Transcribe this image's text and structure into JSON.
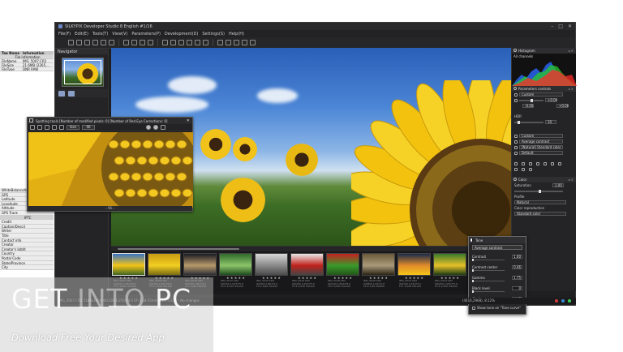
{
  "window": {
    "title": "SILKYPIX Developer Studio 8 English  #1/16",
    "controls": [
      "–",
      "□",
      "✕"
    ]
  },
  "menu": [
    "File(F)",
    "Edit(E)",
    "Tools(T)",
    "View(V)",
    "Parameters(P)",
    "Development(D)",
    "Settings(S)",
    "Help(H)"
  ],
  "navigator": {
    "title": "Navigator"
  },
  "info_table": {
    "header": {
      "key": "Tag Name",
      "value": "Information"
    },
    "section": "File information",
    "rows": [
      {
        "key": "FileName",
        "value": "IMG_5007.CR2"
      },
      {
        "key": "FileSize",
        "value": "21.6MB (2265..."
      },
      {
        "key": "FileType",
        "value": "DNR RAW"
      }
    ]
  },
  "info_lower": [
    {
      "key": "WhiteBalance",
      "value": "Auto white balance"
    },
    {
      "key": "GPS",
      "value": ""
    },
    {
      "key": "Latitude",
      "value": ""
    },
    {
      "key": "Longitude",
      "value": ""
    },
    {
      "key": "Altitude",
      "value": ""
    },
    {
      "key": "GPS Track",
      "value": ""
    },
    {
      "key": "",
      "value": "IPTC",
      "section": true
    },
    {
      "key": "Credit",
      "value": ""
    },
    {
      "key": "Caption/Descri",
      "value": ""
    },
    {
      "key": "Writer",
      "value": ""
    },
    {
      "key": "Title",
      "value": ""
    },
    {
      "key": "Contact info",
      "value": ""
    },
    {
      "key": "Creator",
      "value": ""
    },
    {
      "key": "Creator's Jobtit",
      "value": ""
    },
    {
      "key": "Country",
      "value": ""
    },
    {
      "key": "Postal Code",
      "value": ""
    },
    {
      "key": "State/Province",
      "value": ""
    },
    {
      "key": "City",
      "value": ""
    }
  ],
  "spotting_window": {
    "title": "Spotting tools [Number of modified pixels: 0] [Number of Red Eye Corrections: 0]",
    "zoom": "Size",
    "zoom_value": "96",
    "footer": "‹ 96 ›"
  },
  "histogram": {
    "title": "Histogram",
    "label": "All channels"
  },
  "param_controls": {
    "title": "Parameters controls",
    "preset": "Custom",
    "exposure_value": "+0.00",
    "left_value": "-0.00",
    "right_value": "+0.00",
    "hdr_label": "HDR",
    "hdr_value": "10",
    "wb_preset": "Custom",
    "contrast_preset": "Average contrast",
    "color_preset": "[Natural] Standard color",
    "sharp_preset": "Default"
  },
  "color_panel": {
    "title": "Color",
    "saturation_label": "Saturation",
    "saturation_value": "1.00",
    "profile_label": "Profile",
    "profile_value": "Natural",
    "color_rep_label": "Color reproduction",
    "color_rep_value": "Standard color"
  },
  "tone_popup": {
    "title": "Tone",
    "mode": "Average contrast",
    "rows": [
      {
        "label": "Contrast",
        "value": "1.00"
      },
      {
        "label": "Contrast center",
        "value": "0.46"
      },
      {
        "label": "Gamma",
        "value": "1.75"
      },
      {
        "label": "Black level",
        "value": "0"
      },
      {
        "label": "Clarity",
        "value": "0"
      }
    ],
    "checkbox": "Show tone on \"Tone curve\""
  },
  "filmstrip": {
    "frames": [
      {
        "stars": "★ ★ ★ ★ ★",
        "meta1": "IMG_5007.CR2",
        "meta2": "ISO100 1/250 F8.0",
        "meta3": "F5.6 1/250 ISO100",
        "colors": [
          "#3a73c4",
          "#f2c417",
          "#3d6522"
        ]
      },
      {
        "stars": "★ ★ ★ ★ ★",
        "meta1": "IMG_5008.CR2",
        "meta2": "ISO100 1/320 F8.0",
        "meta3": "F5.6 1/320 ISO100",
        "colors": [
          "#c79a13",
          "#f3cf22",
          "#7a6a12"
        ]
      },
      {
        "stars": "★ ★ ★ ★ ★",
        "meta1": "IMG_5010.CR2",
        "meta2": "ISO200 1/60 F4.0",
        "meta3": "F4.0 1/60 ISO200",
        "colors": [
          "#1a1a22",
          "#b89a6a",
          "#2c2c36"
        ]
      },
      {
        "stars": "★ ★ ★ ★ ★",
        "meta1": "IMG_5012.CR2",
        "meta2": "ISO100 1/125 F5.6",
        "meta3": "F5.6 1/125 ISO100",
        "colors": [
          "#2f6a2a",
          "#8cc46a",
          "#1d4a1c"
        ]
      },
      {
        "stars": "★ ★ ★ ★ ★",
        "meta1": "IMG_5015.CR2",
        "meta2": "ISO400 1/80 F4.0",
        "meta3": "F4.0 1/80 ISO400",
        "colors": [
          "#d8d8d8",
          "#8a8a8a",
          "#4a4a4a"
        ]
      },
      {
        "stars": "★ ★ ★ ★ ★",
        "meta1": "IMG_5016.CR2",
        "meta2": "ISO200 1/200 F5.6",
        "meta3": "F5.6 1/200 ISO200",
        "colors": [
          "#e8e8e8",
          "#c0221c",
          "#444444"
        ]
      },
      {
        "stars": "★ ★ ★ ★ ★",
        "meta1": "IMG_5018.CR2",
        "meta2": "ISO100 1/500 F8.0",
        "meta3": "F8.0 1/500 ISO100",
        "colors": [
          "#c42020",
          "#3a9a2a",
          "#22561a"
        ]
      },
      {
        "stars": "★ ★ ★ ★ ★",
        "meta1": "IMG_5020.CR2",
        "meta2": "ISO800 1/30 F2.8",
        "meta3": "F2.8 1/30 ISO800",
        "colors": [
          "#6a5a3a",
          "#aa9a7a",
          "#2a2214"
        ]
      },
      {
        "stars": "★ ★ ★ ★ ★",
        "meta1": "IMG_5022.CR2",
        "meta2": "ISO100 1/160 F11",
        "meta3": "F11 1/160 ISO100",
        "colors": [
          "#1a2a4a",
          "#e08a2a",
          "#f4c41a"
        ]
      },
      {
        "stars": "★ ★ ★ ★ ★",
        "meta1": "IMG_5024.CR2",
        "meta2": "ISO200 1/250 F5.6",
        "meta3": "F5.6 1/250 ISO200",
        "colors": [
          "#3a7a2a",
          "#e6c02a",
          "#1a3a12"
        ]
      }
    ]
  },
  "statusbar": {
    "left": "IMG_5007.CR2  5184x3456  ISO100  1/250  F8.0  EF-S 18-55mm f/3.5-5.6 IS  –  No changes",
    "right": "(4416,2968), 8:12%"
  },
  "watermark": {
    "logo_a": "GET",
    "logo_b": "INTO",
    "logo_c": "PC",
    "tagline": "Download Free Your Desired App"
  }
}
